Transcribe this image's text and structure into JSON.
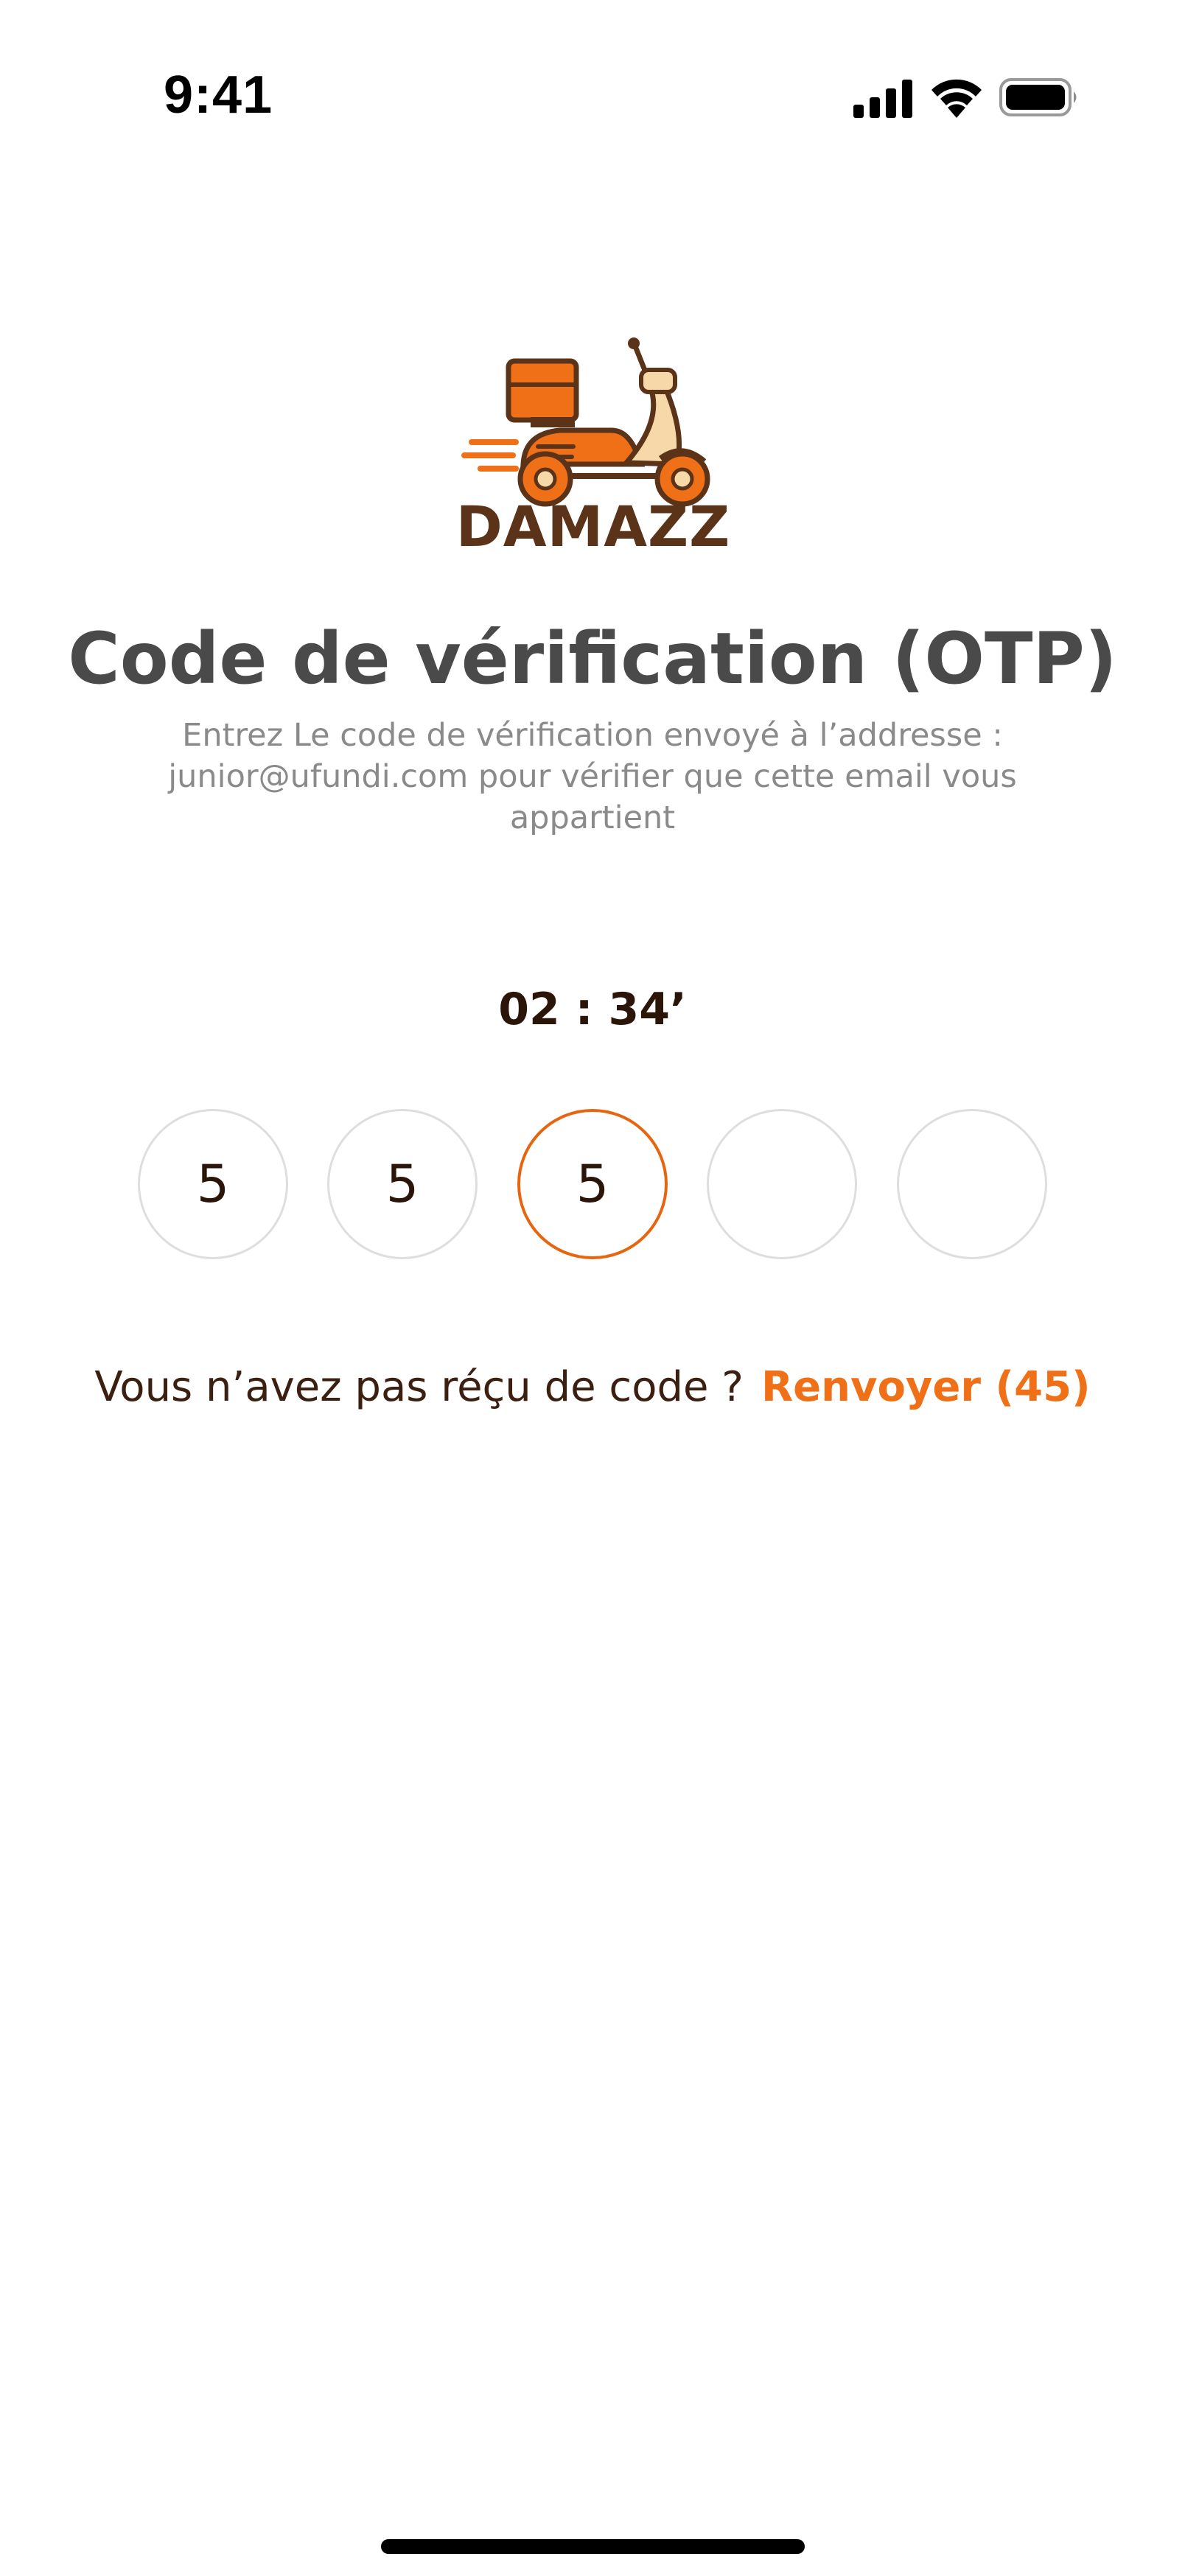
{
  "status_bar": {
    "time": "9:41",
    "icons": [
      "cellular-signal-icon",
      "wifi-icon",
      "battery-icon"
    ]
  },
  "brand": {
    "name": "DAMAZZ",
    "logo_icon": "delivery-scooter-icon",
    "colors": {
      "primary": "#f07018",
      "dark_brown": "#5b3318",
      "cream": "#f7d8a8"
    }
  },
  "verification": {
    "title": "Code de vérification (OTP)",
    "description": "Entrez Le code de vérification envoyé à l’addresse : junior@ufundi.com pour vérifier que cette email vous appartient",
    "timer": "02 : 34’",
    "otp_digits": [
      "5",
      "5",
      "5",
      "",
      ""
    ],
    "active_index": 2
  },
  "resend": {
    "question": "Vous n’avez pas réçu de code ?",
    "link_label": "Renvoyer (45)"
  }
}
